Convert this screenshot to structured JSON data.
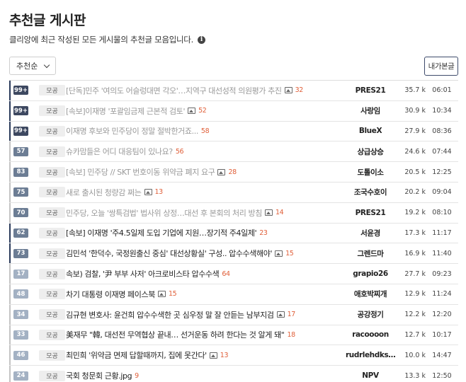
{
  "header": {
    "title": "추천글 게시판",
    "description": "클리앙에 최근 작성된 모든 게시물의 추천글 모음입니다.",
    "info_icon": "i"
  },
  "controls": {
    "sort_value": "추천순",
    "my_posts_label": "내가본글"
  },
  "icons": {
    "image": "image-icon",
    "info": "info-icon",
    "dropdown": "chevron-down-icon"
  },
  "colors": {
    "comment_count": "#e0603a",
    "badge_dark": "#3d4860",
    "badge_mid": "#6c7d94",
    "badge_light": "#a3b1c3"
  },
  "rows": [
    {
      "count": "99+",
      "category": "모공",
      "title": "[단독]민주 '여의도 어슬렁대면 각오'…지역구 대선성적 의원평가 추진",
      "has_image": true,
      "comments": "32",
      "author": "PRES21",
      "views": "35.7 k",
      "time": "06:01",
      "read": true
    },
    {
      "count": "99+",
      "category": "모공",
      "title": "[속보]이재명 '포괄임금제 근본적 검토'",
      "has_image": true,
      "comments": "52",
      "author": "사랑임",
      "views": "30.9 k",
      "time": "10:34",
      "read": true
    },
    {
      "count": "99+",
      "category": "모공",
      "title": "이재명 후보와 민주당이 정말 절박한거죠...",
      "has_image": false,
      "comments": "58",
      "author": "BlueX",
      "views": "27.9 k",
      "time": "08:36",
      "read": true
    },
    {
      "count": "57",
      "category": "모공",
      "title": "슈카맘들은 어디 대응팀이 있나요?",
      "has_image": false,
      "comments": "56",
      "author": "상급상승",
      "views": "24.6 k",
      "time": "07:44",
      "read": true
    },
    {
      "count": "83",
      "category": "모공",
      "title": "[속보] 민주당 // SKT 번호이동 위약금 폐지 요구",
      "has_image": true,
      "comments": "28",
      "author": "도톨이소",
      "views": "20.5 k",
      "time": "12:25",
      "read": true
    },
    {
      "count": "75",
      "category": "모공",
      "title": "새로 출시된 청량감 쩌는",
      "has_image": true,
      "comments": "13",
      "author": "조국수호이",
      "views": "20.2 k",
      "time": "09:04",
      "read": true
    },
    {
      "count": "70",
      "category": "모공",
      "title": "민주당, 오늘 '쌍특검법' 법사위 상정…대선 후 본회의 처리 방침",
      "has_image": true,
      "comments": "14",
      "author": "PRES21",
      "views": "19.2 k",
      "time": "08:10",
      "read": true
    },
    {
      "count": "62",
      "category": "모공",
      "title": "[속보] 이재명 '주4.5일제 도입 기업에 지원…장기적 주4일제'",
      "has_image": false,
      "comments": "23",
      "author": "서윤경",
      "views": "17.3 k",
      "time": "11:17",
      "read": false
    },
    {
      "count": "73",
      "category": "모공",
      "title": "김민석 '한덕수, 국정원출신 중심' 대선상황실' 구성.. 압수수색해야'",
      "has_image": true,
      "comments": "15",
      "author": "그렌드마",
      "views": "16.9 k",
      "time": "11:40",
      "read": false
    },
    {
      "count": "17",
      "category": "모공",
      "title": "속보) 검찰, '尹 부부 사저' 아크로비스타 압수수색",
      "has_image": false,
      "comments": "64",
      "author": "grapio26",
      "views": "27.7 k",
      "time": "09:23",
      "read": false
    },
    {
      "count": "48",
      "category": "모공",
      "title": "차기 대통령 이재명 페이스북",
      "has_image": true,
      "comments": "15",
      "author": "애호박찌개",
      "views": "12.9 k",
      "time": "11:24",
      "read": false
    },
    {
      "count": "34",
      "category": "모공",
      "title": "김규현 변호사: 윤건희 압수수색한 곳 심우정 말 잘 안듣는 남부지검",
      "has_image": true,
      "comments": "17",
      "author": "공강정기",
      "views": "12.2 k",
      "time": "12:20",
      "read": false
    },
    {
      "count": "33",
      "category": "모공",
      "title": "美재무 \"韓, 대선전 무역협상 끝내… 선거운동 하려 한다는 것 알게 돼\"",
      "has_image": false,
      "comments": "18",
      "author": "racoooon",
      "views": "12.7 k",
      "time": "10:17",
      "read": false
    },
    {
      "count": "46",
      "category": "모공",
      "title": "최민희 '위약금 면제 답할때까지, 집에 못간다'",
      "has_image": true,
      "comments": "13",
      "author": "rudrlehdks…",
      "views": "10.0 k",
      "time": "14:47",
      "read": false
    },
    {
      "count": "24",
      "category": "모공",
      "title": "국회 청문회 근황.jpg",
      "has_image": false,
      "comments": "9",
      "author": "NPV",
      "views": "13.3 k",
      "time": "12:50",
      "read": false
    }
  ]
}
